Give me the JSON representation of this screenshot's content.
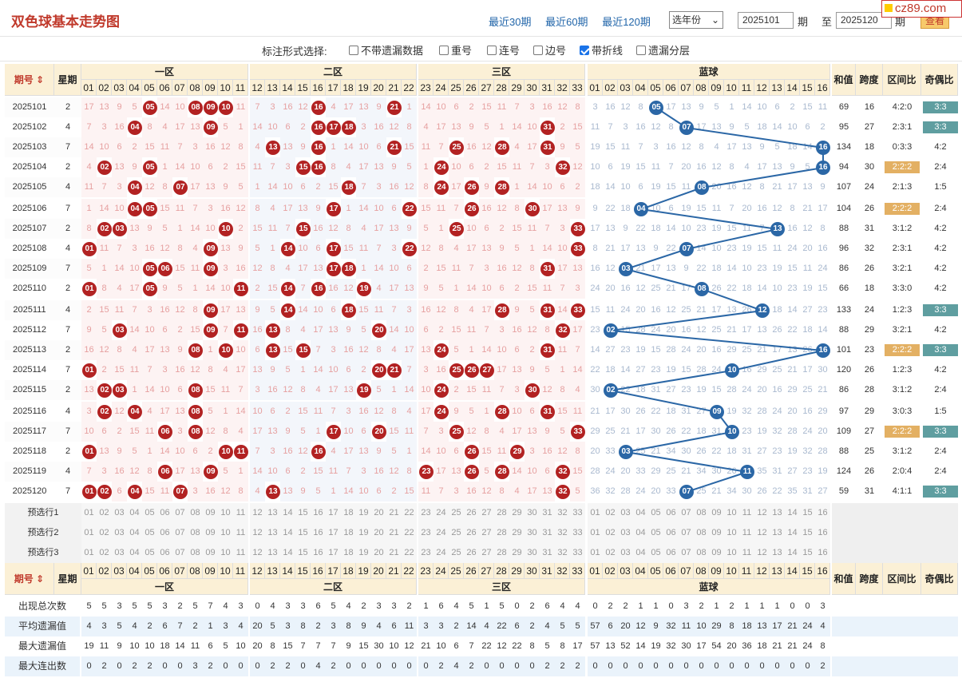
{
  "header": {
    "title": "双色球基本走势图",
    "links": [
      "最近30期",
      "最近60期",
      "最近120期"
    ],
    "year_select": "选年份",
    "from_issue": "2025101",
    "period_lbl": "期",
    "to_lbl": "至",
    "to_issue": "2025120",
    "query": "查看",
    "logo": "cz89.com"
  },
  "options": {
    "label": "标注形式选择:",
    "items": [
      {
        "text": "不带遗漏数据",
        "checked": false
      },
      {
        "text": "重号",
        "checked": false
      },
      {
        "text": "连号",
        "checked": false
      },
      {
        "text": "边号",
        "checked": false
      },
      {
        "text": "带折线",
        "checked": true
      },
      {
        "text": "遗漏分层",
        "checked": false
      }
    ]
  },
  "table_head": {
    "issue": "期号",
    "week": "星期",
    "zone1": "一区",
    "zone2": "二区",
    "zone3": "三区",
    "blue": "蓝球",
    "sum": "和值",
    "span": "跨度",
    "zone_ratio": "区间比",
    "odd_even": "奇偶比"
  },
  "colors": {
    "red_ball": "#b22222",
    "blue_ball": "#2b67a6",
    "line": "#2b67a6"
  },
  "rows": [
    {
      "issue": "2025101",
      "week": "2",
      "reds": [
        5,
        8,
        9,
        10,
        16,
        21
      ],
      "blue": 5,
      "sum": "69",
      "span": "16",
      "zr": "4:2:0",
      "oe": "3:3",
      "oe_hl": true,
      "zr_hl": false
    },
    {
      "issue": "2025102",
      "week": "4",
      "reds": [
        4,
        9,
        16,
        17,
        18,
        31
      ],
      "blue": 7,
      "sum": "95",
      "span": "27",
      "zr": "2:3:1",
      "oe": "3:3",
      "oe_hl": true,
      "zr_hl": false
    },
    {
      "issue": "2025103",
      "week": "7",
      "reds": [
        13,
        16,
        21,
        25,
        28,
        31
      ],
      "blue": 16,
      "sum": "134",
      "span": "18",
      "zr": "0:3:3",
      "oe": "4:2",
      "oe_hl": false,
      "zr_hl": false
    },
    {
      "issue": "2025104",
      "week": "2",
      "reds": [
        2,
        5,
        15,
        16,
        24,
        32
      ],
      "blue": 16,
      "sum": "94",
      "span": "30",
      "zr": "2:2:2",
      "oe": "2:4",
      "oe_hl": false,
      "zr_hl": true
    },
    {
      "issue": "2025105",
      "week": "4",
      "reds": [
        4,
        7,
        18,
        24,
        26,
        28
      ],
      "blue": 8,
      "sum": "107",
      "span": "24",
      "zr": "2:1:3",
      "oe": "1:5",
      "oe_hl": false,
      "zr_hl": false
    },
    {
      "issue": "2025106",
      "week": "7",
      "reds": [
        4,
        5,
        17,
        22,
        26,
        30
      ],
      "blue": 4,
      "sum": "104",
      "span": "26",
      "zr": "2:2:2",
      "oe": "2:4",
      "oe_hl": false,
      "zr_hl": true
    },
    {
      "issue": "2025107",
      "week": "2",
      "reds": [
        2,
        3,
        10,
        15,
        25,
        33
      ],
      "blue": 13,
      "sum": "88",
      "span": "31",
      "zr": "3:1:2",
      "oe": "4:2",
      "oe_hl": false,
      "zr_hl": false
    },
    {
      "issue": "2025108",
      "week": "4",
      "reds": [
        1,
        9,
        14,
        17,
        22,
        33
      ],
      "blue": 7,
      "sum": "96",
      "span": "32",
      "zr": "2:3:1",
      "oe": "4:2",
      "oe_hl": false,
      "zr_hl": false
    },
    {
      "issue": "2025109",
      "week": "7",
      "reds": [
        5,
        6,
        9,
        17,
        18,
        31
      ],
      "blue": 3,
      "sum": "86",
      "span": "26",
      "zr": "3:2:1",
      "oe": "4:2",
      "oe_hl": false,
      "zr_hl": false
    },
    {
      "issue": "2025110",
      "week": "2",
      "reds": [
        1,
        5,
        11,
        14,
        16,
        19
      ],
      "blue": 8,
      "sum": "66",
      "span": "18",
      "zr": "3:3:0",
      "oe": "4:2",
      "oe_hl": false,
      "zr_hl": false
    },
    {
      "issue": "2025111",
      "week": "4",
      "reds": [
        9,
        14,
        18,
        28,
        31,
        33
      ],
      "blue": 12,
      "sum": "133",
      "span": "24",
      "zr": "1:2:3",
      "oe": "3:3",
      "oe_hl": true,
      "zr_hl": false
    },
    {
      "issue": "2025112",
      "week": "7",
      "reds": [
        3,
        9,
        11,
        13,
        20,
        32
      ],
      "blue": 2,
      "sum": "88",
      "span": "29",
      "zr": "3:2:1",
      "oe": "4:2",
      "oe_hl": false,
      "zr_hl": false
    },
    {
      "issue": "2025113",
      "week": "2",
      "reds": [
        8,
        10,
        13,
        15,
        24,
        31
      ],
      "blue": 16,
      "sum": "101",
      "span": "23",
      "zr": "2:2:2",
      "oe": "3:3",
      "oe_hl": true,
      "zr_hl": true
    },
    {
      "issue": "2025114",
      "week": "7",
      "reds": [
        1,
        20,
        21,
        25,
        26,
        27
      ],
      "blue": 10,
      "sum": "120",
      "span": "26",
      "zr": "1:2:3",
      "oe": "4:2",
      "oe_hl": false,
      "zr_hl": false
    },
    {
      "issue": "2025115",
      "week": "2",
      "reds": [
        2,
        3,
        8,
        19,
        24,
        30
      ],
      "blue": 2,
      "sum": "86",
      "span": "28",
      "zr": "3:1:2",
      "oe": "2:4",
      "oe_hl": false,
      "zr_hl": false
    },
    {
      "issue": "2025116",
      "week": "4",
      "reds": [
        2,
        4,
        8,
        24,
        28,
        31
      ],
      "blue": 9,
      "sum": "97",
      "span": "29",
      "zr": "3:0:3",
      "oe": "1:5",
      "oe_hl": false,
      "zr_hl": false
    },
    {
      "issue": "2025117",
      "week": "7",
      "reds": [
        6,
        8,
        17,
        20,
        25,
        33
      ],
      "blue": 10,
      "sum": "109",
      "span": "27",
      "zr": "2:2:2",
      "oe": "3:3",
      "oe_hl": true,
      "zr_hl": true
    },
    {
      "issue": "2025118",
      "week": "2",
      "reds": [
        1,
        10,
        11,
        16,
        26,
        29
      ],
      "blue": 3,
      "sum": "88",
      "span": "25",
      "zr": "3:1:2",
      "oe": "2:4",
      "oe_hl": false,
      "zr_hl": false
    },
    {
      "issue": "2025119",
      "week": "4",
      "reds": [
        6,
        9,
        23,
        26,
        28,
        32
      ],
      "blue": 11,
      "sum": "124",
      "span": "26",
      "zr": "2:0:4",
      "oe": "2:4",
      "oe_hl": false,
      "zr_hl": false
    },
    {
      "issue": "2025120",
      "week": "7",
      "reds": [
        1,
        2,
        4,
        7,
        13,
        32
      ],
      "blue": 7,
      "sum": "59",
      "span": "31",
      "zr": "4:1:1",
      "oe": "3:3",
      "oe_hl": true,
      "zr_hl": false
    }
  ],
  "preselect": [
    "预选行1",
    "预选行2",
    "预选行3"
  ],
  "stats": [
    {
      "label": "出现总次数",
      "red": [
        "5",
        "5",
        "3",
        "5",
        "5",
        "3",
        "2",
        "5",
        "7",
        "4",
        "3",
        "0",
        "4",
        "3",
        "3",
        "6",
        "5",
        "4",
        "2",
        "3",
        "3",
        "2",
        "1",
        "6",
        "4",
        "5",
        "1",
        "5",
        "0",
        "2",
        "6",
        "4",
        "4"
      ],
      "blue": [
        "0",
        "2",
        "2",
        "1",
        "1",
        "0",
        "3",
        "2",
        "1",
        "2",
        "1",
        "1",
        "1",
        "0",
        "0",
        "3"
      ]
    },
    {
      "label": "平均遗漏值",
      "red": [
        "4",
        "3",
        "5",
        "4",
        "2",
        "6",
        "7",
        "2",
        "1",
        "3",
        "4",
        "20",
        "5",
        "3",
        "8",
        "2",
        "3",
        "8",
        "9",
        "4",
        "6",
        "11",
        "3",
        "3",
        "2",
        "14",
        "4",
        "22",
        "6",
        "2",
        "4",
        "5",
        "5"
      ],
      "blue": [
        "57",
        "6",
        "20",
        "12",
        "9",
        "32",
        "11",
        "10",
        "29",
        "8",
        "18",
        "13",
        "17",
        "21",
        "24",
        "4"
      ]
    },
    {
      "label": "最大遗漏值",
      "red": [
        "19",
        "11",
        "9",
        "10",
        "10",
        "18",
        "14",
        "11",
        "6",
        "5",
        "10",
        "20",
        "8",
        "15",
        "7",
        "7",
        "7",
        "9",
        "15",
        "30",
        "10",
        "12",
        "21",
        "10",
        "6",
        "7",
        "22",
        "12",
        "22",
        "8",
        "5",
        "8",
        "17"
      ],
      "blue": [
        "57",
        "13",
        "52",
        "14",
        "19",
        "32",
        "30",
        "17",
        "54",
        "20",
        "36",
        "18",
        "21",
        "21",
        "24",
        "8"
      ]
    },
    {
      "label": "最大连出数",
      "red": [
        "0",
        "2",
        "0",
        "2",
        "2",
        "0",
        "0",
        "3",
        "2",
        "0",
        "0",
        "0",
        "2",
        "2",
        "0",
        "4",
        "2",
        "0",
        "0",
        "0",
        "0",
        "0",
        "0",
        "2",
        "4",
        "2",
        "0",
        "0",
        "0",
        "0",
        "2",
        "2",
        "2"
      ],
      "blue": [
        "0",
        "0",
        "0",
        "0",
        "0",
        "0",
        "0",
        "0",
        "0",
        "0",
        "0",
        "0",
        "0",
        "0",
        "0",
        "2"
      ]
    }
  ]
}
